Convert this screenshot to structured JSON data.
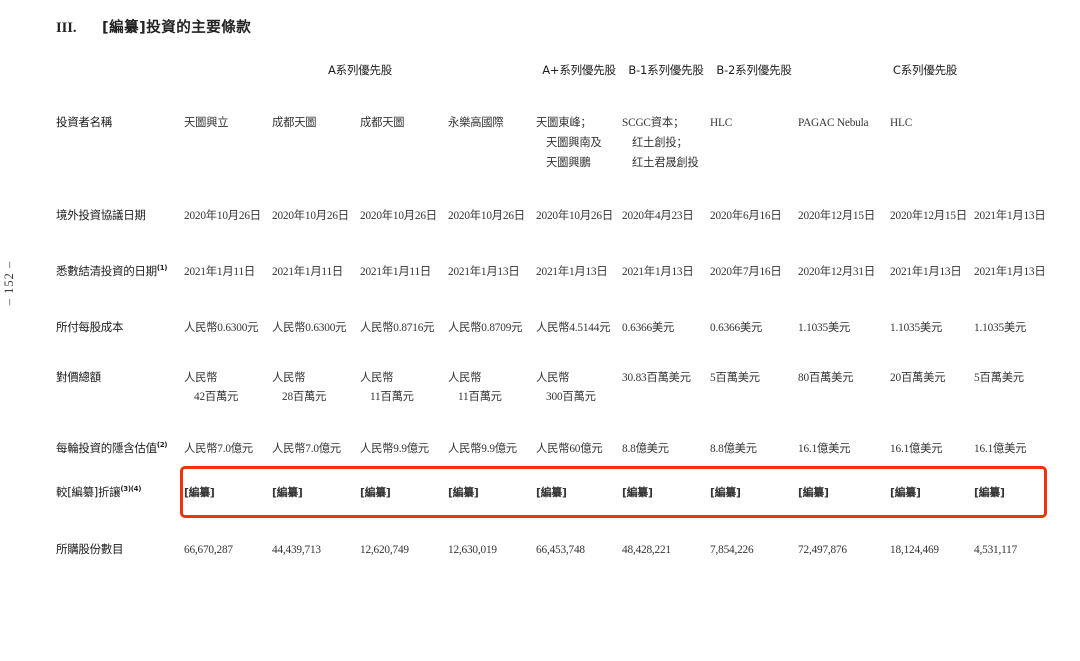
{
  "page": {
    "folio": "– 152 –",
    "heading_number": "III.",
    "heading_text": "[編纂]投資的主要條款"
  },
  "table": {
    "group_headers": [
      {
        "label": "A系列優先股"
      },
      {
        "label": "A+系列優先股"
      },
      {
        "label": "B-1系列優先股"
      },
      {
        "label": "B-2系列優先股"
      },
      {
        "label": "C系列優先股"
      }
    ],
    "row_labels": {
      "investor_name": "投資者名稱",
      "offshore_agreement_date": "境外投資協議日期",
      "settlement_date": "悉數結清投資的日期",
      "settlement_date_sup": "(1)",
      "cost_per_share": "所付每股成本",
      "total_consideration": "對價總額",
      "implied_valuation": "每輪投資的隱含估值",
      "implied_valuation_sup": "(2)",
      "discount": "較[編纂]折讓",
      "discount_sup": "(3)(4)",
      "shares_purchased": "所購股份數目"
    },
    "investor_names": [
      [
        "天圖興立"
      ],
      [
        "成都天圖"
      ],
      [
        "成都天圖"
      ],
      [
        "永樂高國際"
      ],
      [
        "天圖東峰；",
        "天圖興南及",
        "天圖興鵬"
      ],
      [
        "SCGC資本；",
        "红土創投；",
        "红土君晟創投"
      ],
      [
        "HLC"
      ],
      [
        "PAGAC Nebula"
      ],
      [
        "HLC"
      ],
      [
        ""
      ]
    ],
    "offshore_agreement_dates": [
      "2020年10月26日",
      "2020年10月26日",
      "2020年10月26日",
      "2020年10月26日",
      "2020年10月26日",
      "2020年4月23日",
      "2020年6月16日",
      "2020年12月15日",
      "2020年12月15日",
      "2021年1月13日"
    ],
    "settlement_dates": [
      "2021年1月11日",
      "2021年1月11日",
      "2021年1月11日",
      "2021年1月13日",
      "2021年1月13日",
      "2021年1月13日",
      "2020年7月16日",
      "2020年12月31日",
      "2021年1月13日",
      "2021年1月13日"
    ],
    "cost_per_share": [
      "人民幣0.6300元",
      "人民幣0.6300元",
      "人民幣0.8716元",
      "人民幣0.8709元",
      "人民幣4.5144元",
      "0.6366美元",
      "0.6366美元",
      "1.1035美元",
      "1.1035美元",
      "1.1035美元"
    ],
    "total_consideration": [
      [
        "人民幣",
        "42百萬元"
      ],
      [
        "人民幣",
        "28百萬元"
      ],
      [
        "人民幣",
        "11百萬元"
      ],
      [
        "人民幣",
        "11百萬元"
      ],
      [
        "人民幣",
        "300百萬元"
      ],
      [
        "30.83百萬美元"
      ],
      [
        "5百萬美元"
      ],
      [
        "80百萬美元"
      ],
      [
        "20百萬美元"
      ],
      [
        "5百萬美元"
      ]
    ],
    "implied_valuation": [
      "人民幣7.0億元",
      "人民幣7.0億元",
      "人民幣9.9億元",
      "人民幣9.9億元",
      "人民幣60億元",
      "8.8億美元",
      "8.8億美元",
      "16.1億美元",
      "16.1億美元",
      "16.1億美元"
    ],
    "discount": [
      "[編纂]",
      "[編纂]",
      "[編纂]",
      "[編纂]",
      "[編纂]",
      "[編纂]",
      "[編纂]",
      "[編纂]",
      "[編纂]",
      "[編纂]"
    ],
    "shares_purchased": [
      "66,670,287",
      "44,439,713",
      "12,620,749",
      "12,630,019",
      "66,453,748",
      "48,428,221",
      "7,854,226",
      "72,497,876",
      "18,124,469",
      "4,531,117"
    ]
  },
  "annotation": {
    "highlight_color": "#f0320a",
    "highlight_target": "implied_valuation"
  }
}
